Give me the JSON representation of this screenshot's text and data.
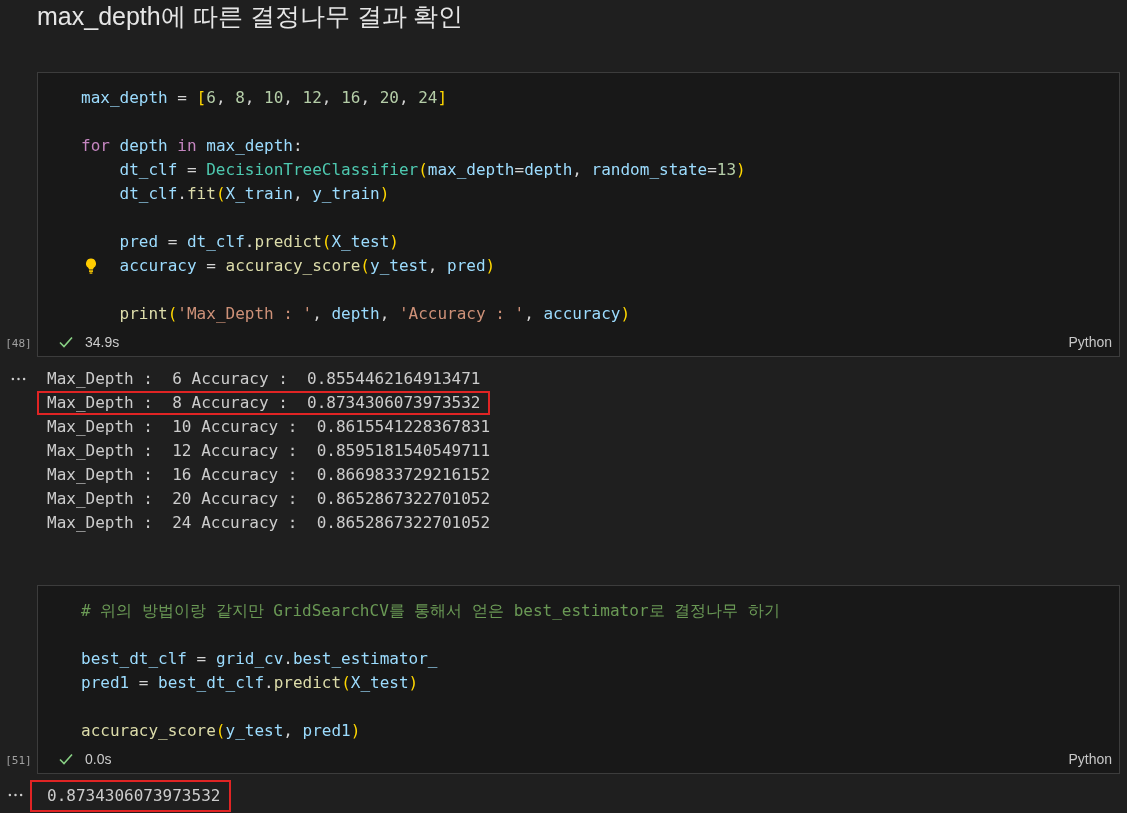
{
  "heading": "max_depth에 따른 결정나무 결과 확인",
  "cells": [
    {
      "execution_count": "[48]",
      "language": "Python",
      "status": {
        "success": true,
        "duration": "34.9s"
      },
      "code": [
        {
          "kind": "code",
          "tokens": [
            {
              "text": "max_depth",
              "kind": "var"
            },
            {
              "text": " = ",
              "kind": "op"
            },
            {
              "text": "[",
              "kind": "bracket"
            },
            {
              "text": "6",
              "kind": "num"
            },
            {
              "text": ", ",
              "kind": "op"
            },
            {
              "text": "8",
              "kind": "num"
            },
            {
              "text": ", ",
              "kind": "op"
            },
            {
              "text": "10",
              "kind": "num"
            },
            {
              "text": ", ",
              "kind": "op"
            },
            {
              "text": "12",
              "kind": "num"
            },
            {
              "text": ", ",
              "kind": "op"
            },
            {
              "text": "16",
              "kind": "num"
            },
            {
              "text": ", ",
              "kind": "op"
            },
            {
              "text": "20",
              "kind": "num"
            },
            {
              "text": ", ",
              "kind": "op"
            },
            {
              "text": "24",
              "kind": "num"
            },
            {
              "text": "]",
              "kind": "bracket"
            }
          ]
        },
        {
          "kind": "blank"
        },
        {
          "kind": "code",
          "tokens": [
            {
              "text": "for",
              "kind": "keyword"
            },
            {
              "text": " depth ",
              "kind": "var"
            },
            {
              "text": "in",
              "kind": "keyword"
            },
            {
              "text": " max_depth",
              "kind": "var"
            },
            {
              "text": ":",
              "kind": "op"
            }
          ]
        },
        {
          "kind": "code",
          "tokens": [
            {
              "text": "    dt_clf",
              "kind": "var"
            },
            {
              "text": " = ",
              "kind": "op"
            },
            {
              "text": "DecisionTreeClassifier",
              "kind": "class"
            },
            {
              "text": "(",
              "kind": "bracket"
            },
            {
              "text": "max_depth",
              "kind": "var"
            },
            {
              "text": "=",
              "kind": "op"
            },
            {
              "text": "depth",
              "kind": "var"
            },
            {
              "text": ", ",
              "kind": "op"
            },
            {
              "text": "random_state",
              "kind": "var"
            },
            {
              "text": "=",
              "kind": "op"
            },
            {
              "text": "13",
              "kind": "num"
            },
            {
              "text": ")",
              "kind": "bracket"
            }
          ]
        },
        {
          "kind": "code",
          "tokens": [
            {
              "text": "    dt_clf",
              "kind": "var"
            },
            {
              "text": ".",
              "kind": "op"
            },
            {
              "text": "fit",
              "kind": "func"
            },
            {
              "text": "(",
              "kind": "bracket"
            },
            {
              "text": "X_train",
              "kind": "var"
            },
            {
              "text": ", ",
              "kind": "op"
            },
            {
              "text": "y_train",
              "kind": "var"
            },
            {
              "text": ")",
              "kind": "bracket"
            }
          ]
        },
        {
          "kind": "blank"
        },
        {
          "kind": "code",
          "tokens": [
            {
              "text": "    pred",
              "kind": "var"
            },
            {
              "text": " = ",
              "kind": "op"
            },
            {
              "text": "dt_clf",
              "kind": "var"
            },
            {
              "text": ".",
              "kind": "op"
            },
            {
              "text": "predict",
              "kind": "func"
            },
            {
              "text": "(",
              "kind": "bracket"
            },
            {
              "text": "X_test",
              "kind": "var"
            },
            {
              "text": ")",
              "kind": "bracket"
            }
          ]
        },
        {
          "kind": "hint",
          "tokens": [
            {
              "text": "    accuracy",
              "kind": "var"
            },
            {
              "text": " = ",
              "kind": "op"
            },
            {
              "text": "accuracy_score",
              "kind": "func"
            },
            {
              "text": "(",
              "kind": "bracket"
            },
            {
              "text": "y_test",
              "kind": "var"
            },
            {
              "text": ", ",
              "kind": "op"
            },
            {
              "text": "pred",
              "kind": "var"
            },
            {
              "text": ")",
              "kind": "bracket"
            }
          ]
        },
        {
          "kind": "blank"
        },
        {
          "kind": "code",
          "tokens": [
            {
              "text": "    print",
              "kind": "func"
            },
            {
              "text": "(",
              "kind": "bracket"
            },
            {
              "text": "'Max_Depth : '",
              "kind": "str"
            },
            {
              "text": ", ",
              "kind": "op"
            },
            {
              "text": "depth",
              "kind": "var"
            },
            {
              "text": ", ",
              "kind": "op"
            },
            {
              "text": "'Accuracy : '",
              "kind": "str"
            },
            {
              "text": ", ",
              "kind": "op"
            },
            {
              "text": "accuracy",
              "kind": "var"
            },
            {
              "text": ")",
              "kind": "bracket"
            }
          ]
        }
      ],
      "output": {
        "kind": "stream",
        "lines": [
          {
            "text": "Max_Depth :  6 Accuracy :  0.8554462164913471",
            "highlighted": false
          },
          {
            "text": "Max_Depth :  8 Accuracy :  0.8734306073973532",
            "highlighted": true
          },
          {
            "text": "Max_Depth :  10 Accuracy :  0.8615541228367831",
            "highlighted": false
          },
          {
            "text": "Max_Depth :  12 Accuracy :  0.8595181540549711",
            "highlighted": false
          },
          {
            "text": "Max_Depth :  16 Accuracy :  0.8669833729216152",
            "highlighted": false
          },
          {
            "text": "Max_Depth :  20 Accuracy :  0.8652867322701052",
            "highlighted": false
          },
          {
            "text": "Max_Depth :  24 Accuracy :  0.8652867322701052",
            "highlighted": false
          }
        ]
      }
    },
    {
      "execution_count": "[51]",
      "language": "Python",
      "status": {
        "success": true,
        "duration": "0.0s"
      },
      "code": [
        {
          "kind": "code",
          "tokens": [
            {
              "text": "# 위의 방법이랑 같지만 GridSearchCV를 통해서 얻은 best_estimator로 결정나무 하기",
              "kind": "comment"
            }
          ]
        },
        {
          "kind": "blank"
        },
        {
          "kind": "code",
          "tokens": [
            {
              "text": "best_dt_clf",
              "kind": "var"
            },
            {
              "text": " = ",
              "kind": "op"
            },
            {
              "text": "grid_cv",
              "kind": "var"
            },
            {
              "text": ".",
              "kind": "op"
            },
            {
              "text": "best_estimator_",
              "kind": "var"
            }
          ]
        },
        {
          "kind": "code",
          "tokens": [
            {
              "text": "pred1",
              "kind": "var"
            },
            {
              "text": " = ",
              "kind": "op"
            },
            {
              "text": "best_dt_clf",
              "kind": "var"
            },
            {
              "text": ".",
              "kind": "op"
            },
            {
              "text": "predict",
              "kind": "func"
            },
            {
              "text": "(",
              "kind": "bracket"
            },
            {
              "text": "X_test",
              "kind": "var"
            },
            {
              "text": ")",
              "kind": "bracket"
            }
          ]
        },
        {
          "kind": "blank"
        },
        {
          "kind": "code",
          "tokens": [
            {
              "text": "accuracy_score",
              "kind": "func"
            },
            {
              "text": "(",
              "kind": "bracket"
            },
            {
              "text": "y_test",
              "kind": "var"
            },
            {
              "text": ", ",
              "kind": "op"
            },
            {
              "text": "pred1",
              "kind": "var"
            },
            {
              "text": ")",
              "kind": "bracket"
            }
          ]
        }
      ],
      "output": {
        "kind": "result",
        "lines": [
          {
            "text": "0.8734306073973532",
            "highlighted": true
          }
        ]
      }
    }
  ]
}
